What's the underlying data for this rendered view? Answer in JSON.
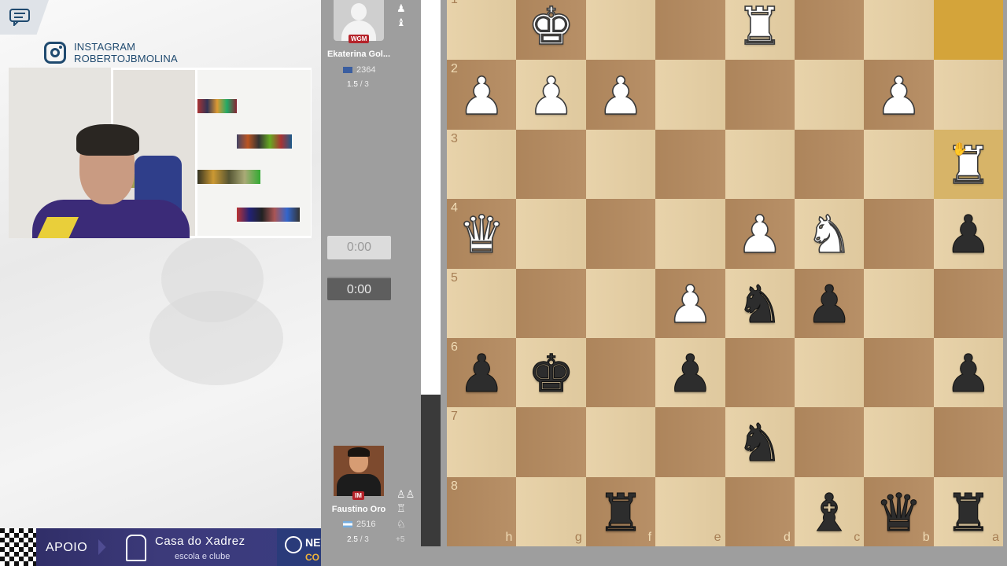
{
  "instagram": {
    "label": "INSTAGRAM",
    "handle": "ROBERTOJBMOLINA"
  },
  "sponsor": {
    "apoio": "APOIO",
    "casa_name": "Casa do Xadrez",
    "casa_sub": "escola e clube",
    "partner_text": "NEV",
    "partner_sub": "CO"
  },
  "top_player": {
    "title": "WGM",
    "name": "Ekaterina Gol...",
    "rating": "2364",
    "score": "1.5",
    "rounds": "/ 3",
    "flag_color": "#3a5ea0",
    "captured_icons": [
      "pawn-icon",
      "bishop-icon"
    ]
  },
  "bottom_player": {
    "title": "IM",
    "name": "Faustino Oro",
    "rating": "2516",
    "score": "2.5",
    "rounds": "/ 3",
    "material_adv": "+5",
    "flag_color": "#74acdf",
    "captured_icons": [
      "pawns-icon",
      "rooks-icon",
      "knight-icon"
    ]
  },
  "clocks": {
    "top": "0:00",
    "bottom": "0:00"
  },
  "board": {
    "orientation": "black",
    "ranks": [
      "1",
      "2",
      "3",
      "4",
      "5",
      "6",
      "7",
      "8"
    ],
    "files": [
      "h",
      "g",
      "f",
      "e",
      "d",
      "c",
      "b",
      "a"
    ],
    "rows": [
      [
        "",
        "wK",
        "",
        "",
        "wR",
        "",
        "",
        ""
      ],
      [
        "wP",
        "wP",
        "wP",
        "",
        "",
        "",
        "wP",
        ""
      ],
      [
        "",
        "",
        "",
        "",
        "",
        "",
        "",
        "wR"
      ],
      [
        "wQ",
        "",
        "",
        "",
        "wP",
        "wN",
        "",
        "bP"
      ],
      [
        "",
        "",
        "",
        "wP",
        "bN",
        "bP",
        "",
        ""
      ],
      [
        "bP",
        "bK",
        "",
        "bP",
        "",
        "",
        "",
        "bP"
      ],
      [
        "",
        "",
        "",
        "",
        "bN",
        "",
        "",
        ""
      ],
      [
        "",
        "",
        "bR",
        "",
        "",
        "bB",
        "bQ",
        "bR"
      ]
    ],
    "highlights": {
      "from": [
        0,
        7
      ],
      "to": [
        2,
        7
      ]
    }
  }
}
